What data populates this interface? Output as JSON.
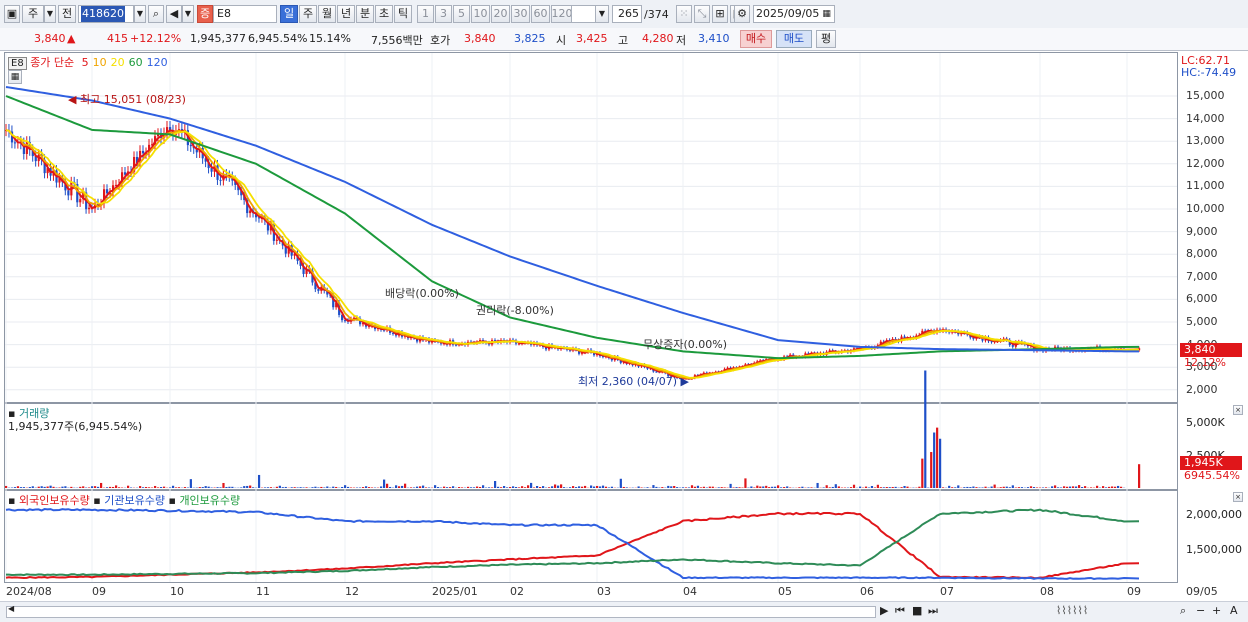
{
  "toolbar": {
    "market_label": "주",
    "prev_label": "전",
    "code": "418620",
    "type_badge": "증",
    "name": "E8",
    "periods": [
      "일",
      "주",
      "월",
      "년",
      "분",
      "초",
      "틱"
    ],
    "active_period": "일",
    "intervals": [
      "1",
      "3",
      "5",
      "10",
      "20",
      "30",
      "60",
      "120"
    ],
    "count": "265",
    "total": "/374",
    "date": "2025/09/05"
  },
  "quote": {
    "price": "3,840",
    "arrow": "▲",
    "change": "415",
    "change_pct": "+12.12%",
    "volume": "1,945,377",
    "volume_pct": "6,945.54%",
    "turnover": "15.14%",
    "amount": "7,556백만",
    "hoga_label": "호가",
    "ask": "3,840",
    "bid": "3,825",
    "open_label": "시",
    "open": "3,425",
    "high_label": "고",
    "high": "4,280",
    "low_label": "저",
    "low": "3,410",
    "buy_label": "매수",
    "sell_label": "매도",
    "eval_label": "평"
  },
  "price_panel": {
    "title": "E8",
    "ma_label": "종가 단순",
    "ma_periods": [
      "5",
      "10",
      "20",
      "60",
      "120"
    ],
    "ma_colors": [
      "#e0161a",
      "#f0a400",
      "#f5e000",
      "#1c9a3c",
      "#2f5fe0"
    ],
    "lc": "LC:62.71",
    "hc": "HC:-74.49",
    "y_ticks": [
      "15,000",
      "14,000",
      "13,000",
      "12,000",
      "11,000",
      "10,000",
      "9,000",
      "8,000",
      "7,000",
      "6,000",
      "5,000",
      "4,000",
      "3,000",
      "2,000"
    ],
    "current_tag": "3,840",
    "pct_tag": "12.12%",
    "annotations": {
      "high": "최고 15,051 (08/23)",
      "low": "최저 2,360 (04/07)",
      "dividend": "배당락(0.00%)",
      "rights": "권리락(-8.00%)",
      "capital": "무상증자(0.00%)"
    }
  },
  "volume_panel": {
    "title": "거래량",
    "value": "1,945,377주(6,945.54%)",
    "y_ticks": [
      "5,000K",
      "2,500K"
    ],
    "current_tag": "1,945K",
    "pct_tag": "6945.54%"
  },
  "holding_panel": {
    "legend": [
      "외국인보유수량",
      "기관보유수량",
      "개인보유수량"
    ],
    "y_ticks": [
      "2,000,000",
      "1,500,000"
    ]
  },
  "x_axis": [
    "2024/08",
    "09",
    "10",
    "11",
    "12",
    "2025/01",
    "02",
    "03",
    "04",
    "05",
    "06",
    "07",
    "08",
    "09",
    "09/05"
  ],
  "chart_data": [
    {
      "type": "line",
      "title": "E8",
      "series_names": [
        "종가 단순 5",
        "10",
        "20",
        "60",
        "120"
      ],
      "ylim": [
        2000,
        15500
      ],
      "x_months": [
        "2024/08",
        "09",
        "10",
        "11",
        "12",
        "2025/01",
        "02",
        "03",
        "04",
        "05",
        "06",
        "07",
        "08",
        "09"
      ],
      "close_monthly_approx": [
        13500,
        10000,
        13800,
        9800,
        5200,
        4100,
        4100,
        3600,
        2500,
        3400,
        3800,
        4700,
        3800,
        3840
      ],
      "ma120_monthly_approx": [
        15400,
        14800,
        14000,
        12800,
        11200,
        9300,
        7900,
        6600,
        5400,
        4200,
        3900,
        3800,
        3750,
        3700
      ],
      "ma60_monthly_approx": [
        15000,
        13500,
        13300,
        12000,
        9800,
        6800,
        5200,
        4300,
        3700,
        3400,
        3500,
        3700,
        3800,
        3900
      ]
    },
    {
      "type": "bar",
      "title": "거래량",
      "ylim": [
        0,
        6000000
      ],
      "peak_month": "07",
      "peak_value_approx": 5200000,
      "last_value": 1945377
    },
    {
      "type": "line",
      "series": [
        {
          "name": "외국인보유수량",
          "values_approx": [
            1260000,
            1270000,
            1300000,
            1330000,
            1380000,
            1450000,
            1500000,
            1550000,
            2000000,
            2100000,
            2100000,
            1270000,
            1260000,
            1450000
          ]
        },
        {
          "name": "기관보유수량",
          "values_approx": [
            2150000,
            2150000,
            2140000,
            2120000,
            2000000,
            2000000,
            1950000,
            1950000,
            1260000,
            1260000,
            1260000,
            1260000,
            1250000,
            1250000
          ]
        },
        {
          "name": "개인보유수량",
          "values_approx": [
            1300000,
            1300000,
            1310000,
            1320000,
            1350000,
            1400000,
            1430000,
            1450000,
            1500000,
            1450000,
            1420000,
            2100000,
            2150000,
            2000000
          ]
        }
      ],
      "ylim": [
        1230000,
        2200000
      ]
    }
  ]
}
